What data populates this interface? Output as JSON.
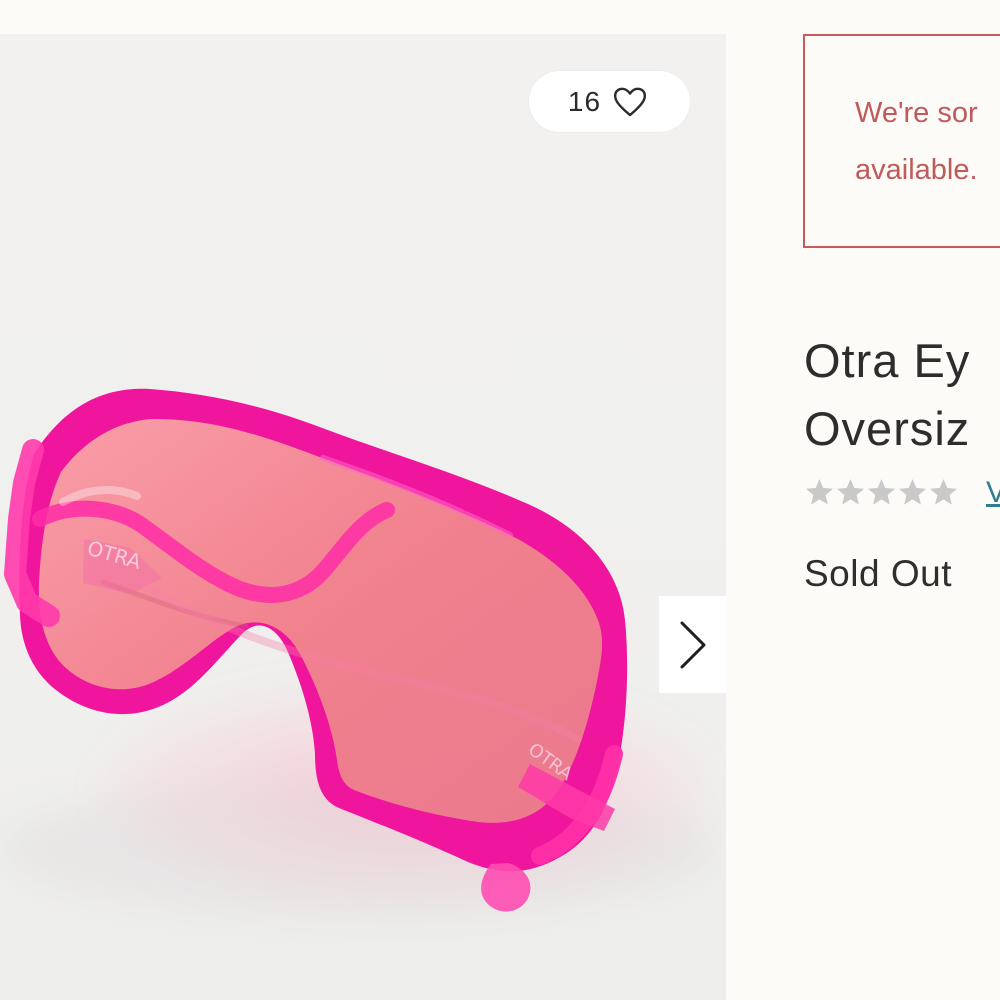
{
  "product": {
    "like_count": "16",
    "alert_lines": [
      "We're sor",
      "available."
    ],
    "title_lines": [
      "Otra Ey",
      "Oversiz"
    ],
    "rating_stars": 0,
    "reviews_link_fragment": "V",
    "availability": "Sold Out"
  },
  "icons": {
    "heart": "heart-icon",
    "next": "chevron-right-icon",
    "star": "star-icon"
  },
  "colors": {
    "background": "#fcfbf7",
    "image_background": "#f2f1f0",
    "alert_red": "#c05a5a",
    "alert_border": "#c75b5b",
    "title_text": "#2e2d2d",
    "star_empty": "#c9c9c9",
    "link_teal": "#2f7f92",
    "sunglasses_pink": "#f0149c",
    "lens_pink": "#f27d92"
  }
}
